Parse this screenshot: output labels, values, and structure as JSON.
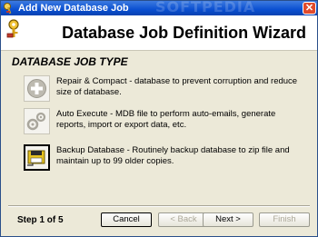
{
  "window": {
    "title": "Add New Database Job",
    "watermark": "SOFTPEDIA"
  },
  "header": {
    "heading": "Database Job Definition Wizard"
  },
  "section": {
    "title": "DATABASE JOB TYPE"
  },
  "jobs": [
    {
      "name": "repair-compact",
      "text": "Repair & Compact - database to prevent corruption and reduce size of database.",
      "selected": false
    },
    {
      "name": "auto-execute",
      "text": "Auto Execute - MDB file to perform auto-emails, generate reports, import or export data, etc.",
      "selected": false
    },
    {
      "name": "backup-database",
      "text": "Backup Database - Routinely backup database to zip file and maintain up to 99 older copies.",
      "selected": true
    }
  ],
  "footer": {
    "step": "Step 1 of 5",
    "cancel": "Cancel",
    "back": "< Back",
    "next": "Next >",
    "finish": "Finish"
  },
  "colors": {
    "titlebar": "#0a4fd1",
    "window_bg": "#ece9d8",
    "close": "#e04a2c"
  }
}
